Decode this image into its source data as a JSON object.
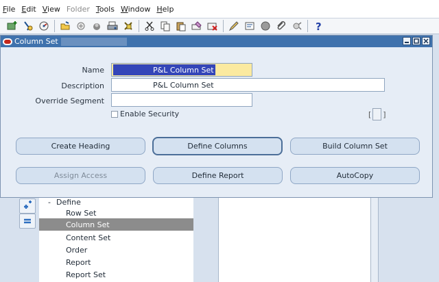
{
  "menubar": {
    "items": [
      {
        "label": "File",
        "acc": "F",
        "rest": "ile",
        "enabled": true
      },
      {
        "label": "Edit",
        "acc": "E",
        "rest": "dit",
        "enabled": true
      },
      {
        "label": "View",
        "acc": "V",
        "rest": "iew",
        "enabled": true
      },
      {
        "label": "Folder",
        "acc": "",
        "rest": "Folder",
        "enabled": false
      },
      {
        "label": "Tools",
        "acc": "T",
        "rest": "ools",
        "enabled": true
      },
      {
        "label": "Window",
        "acc": "W",
        "rest": "indow",
        "enabled": true
      },
      {
        "label": "Help",
        "acc": "H",
        "rest": "elp",
        "enabled": true
      }
    ]
  },
  "toolbar": {
    "icons": [
      "new-icon",
      "find-icon",
      "navigator-icon",
      "open-folder-icon",
      "save-icon",
      "switch-responsibility-icon",
      "print-icon",
      "close-form-icon",
      "cut-icon",
      "copy-icon",
      "paste-icon",
      "clear-record-icon",
      "delete-record-icon",
      "edit-field-icon",
      "zoom-icon",
      "translations-icon",
      "attachments-icon",
      "folder-tools-icon",
      "help-icon"
    ]
  },
  "window": {
    "title": "Column Set",
    "controls": [
      "minimize-icon",
      "maximize-icon",
      "close-icon"
    ],
    "name_label": "Name",
    "name_value": "P&L Column Set",
    "description_label": "Description",
    "description_value": "P&L Column Set",
    "override_label": "Override Segment",
    "override_value": "",
    "enable_security_label": "Enable Security",
    "enable_security_checked": false,
    "attachment_left": "[",
    "attachment_right": "]",
    "buttons": {
      "create_heading": "Create Heading",
      "define_columns": "Define Columns",
      "build_column_set": "Build Column Set",
      "assign_access": "Assign Access",
      "define_report": "Define Report",
      "autocopy": "AutoCopy"
    }
  },
  "navigator": {
    "node": "Define",
    "node_prefix": "-",
    "items": [
      "Row Set",
      "Column Set",
      "Content Set",
      "Order",
      "Report",
      "Report Set"
    ],
    "selected": "Column Set"
  },
  "colors": {
    "title_bar": "#3f72ad",
    "selection": "#3446b8",
    "required_field": "#fbeaa0",
    "tree_selected": "#8c8c8c"
  }
}
